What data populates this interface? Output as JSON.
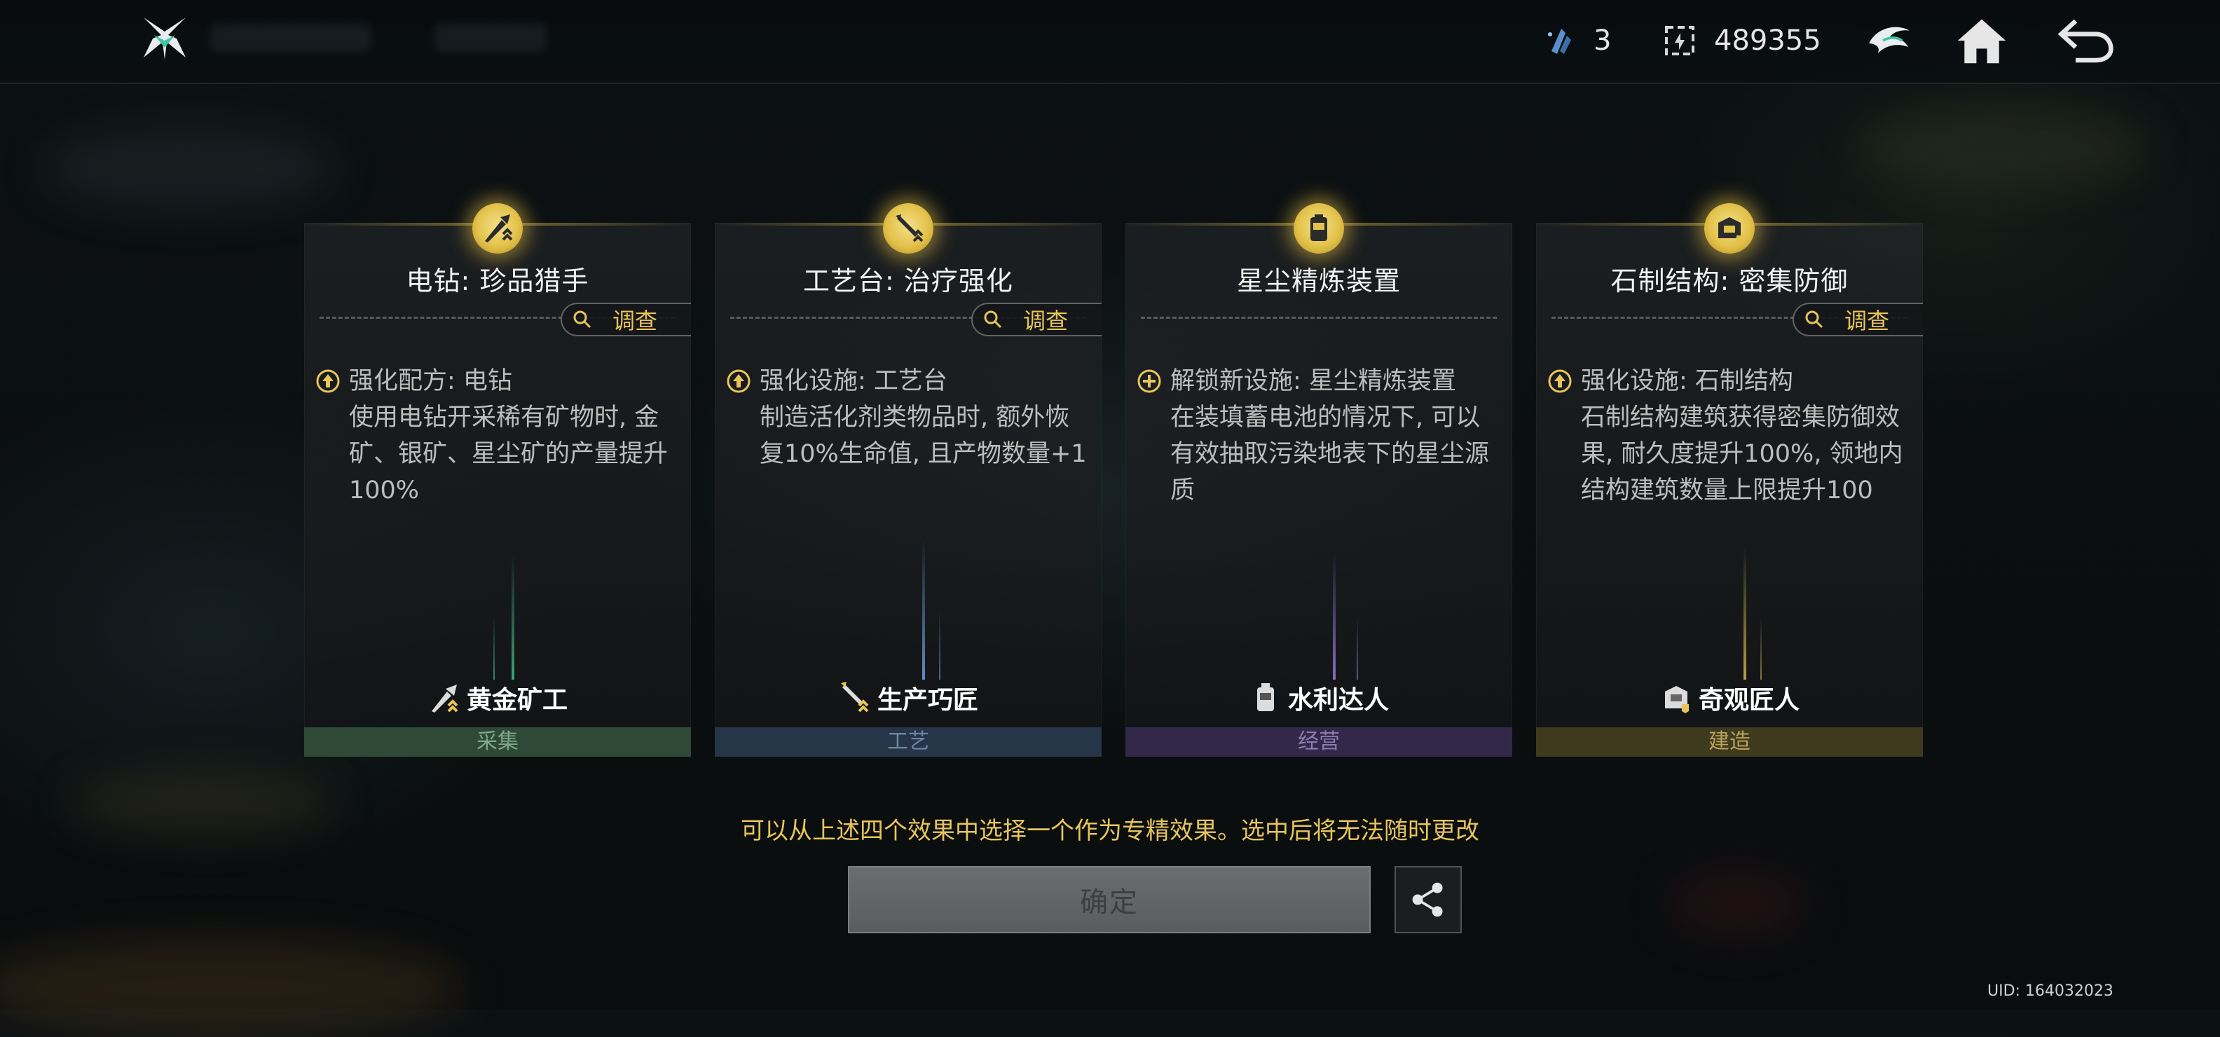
{
  "header": {
    "currency_1": {
      "icon": "crystal-shard-icon",
      "value": "3"
    },
    "currency_2": {
      "icon": "coin-box-icon",
      "value": "489355"
    },
    "buttons": [
      "emblem-icon",
      "home-icon",
      "back-icon"
    ]
  },
  "cards": [
    {
      "title": "电钻: 珍品猎手",
      "investigate": "调查",
      "effect_head": "强化配方: 电钻",
      "effect_body": "使用电钻开采稀有矿物时, 金矿、银矿、星尘矿的产量提升100%",
      "skill": "黄金矿工",
      "category": "采集",
      "category_color": "#2e4a36",
      "category_text_color": "#7fa88a",
      "glow_color": "#3fbf86",
      "effect_icon": "upgrade-icon"
    },
    {
      "title": "工艺台: 治疗强化",
      "investigate": "调查",
      "effect_head": "强化设施: 工艺台",
      "effect_body": "制造活化剂类物品时, 额外恢复10%生命值, 且产物数量+1",
      "skill": "生产巧匠",
      "category": "工艺",
      "category_color": "#263548",
      "category_text_color": "#6f87a8",
      "glow_color": "#6fa0e0",
      "effect_icon": "upgrade-icon"
    },
    {
      "title": "星尘精炼装置",
      "investigate": "",
      "effect_head": "解锁新设施: 星尘精炼装置",
      "effect_body": "在装填蓄电池的情况下, 可以有效抽取污染地表下的星尘源质",
      "skill": "水利达人",
      "category": "经营",
      "category_color": "#33284a",
      "category_text_color": "#8c7cb0",
      "glow_color": "#9b7ce0",
      "effect_icon": "unlock-icon"
    },
    {
      "title": "石制结构: 密集防御",
      "investigate": "调查",
      "effect_head": "强化设施: 石制结构",
      "effect_body": "石制结构建筑获得密集防御效果, 耐久度提升100%, 领地内结构建筑数量上限提升100",
      "skill": "奇观匠人",
      "category": "建造",
      "category_color": "#3f3a1e",
      "category_text_color": "#b8a25c",
      "glow_color": "#d6b64a",
      "effect_icon": "upgrade-icon"
    }
  ],
  "hint": "可以从上述四个效果中选择一个作为专精效果。选中后将无法随时更改",
  "confirm_label": "确定",
  "uid": "UID: 164032023"
}
